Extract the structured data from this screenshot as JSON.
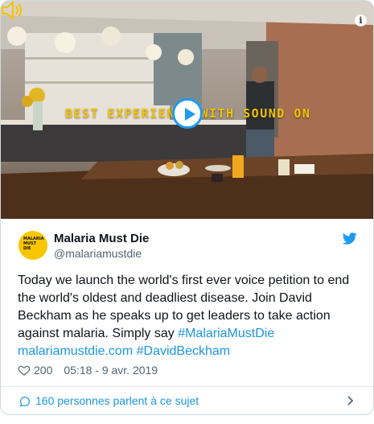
{
  "tweet": {
    "display_name": "Malaria Must Die",
    "handle": "@malariamustdie",
    "avatar_text": "MALARIA MUST DIE",
    "text_plain": "Today we launch the world's first ever voice petition to end the world's oldest and deadliest disease. Join David Beckham as he speaks up to get leaders to take action against malaria. Simply say ",
    "hashtag_1": "#MalariaMustDie",
    "link": "malariamustdie.com",
    "hashtag_2": "#DavidBeckham",
    "likes": "200",
    "timestamp": "05:18 - 9 avr. 2019",
    "conversation_label": "160 personnes parlent à ce sujet"
  },
  "media": {
    "banner_text": "BEST EXPERIENCE WITH SOUND ON",
    "info_label": "i"
  },
  "colors": {
    "link": "#1b95e0",
    "play_accent": "#1d9bf0",
    "banner_yellow": "#f2c300",
    "avatar_yellow": "#f7c600"
  },
  "icons": [
    "info-icon",
    "play-icon",
    "speaker-icon",
    "twitter-bird-icon",
    "heart-icon",
    "reply-icon",
    "chevron-right-icon"
  ]
}
